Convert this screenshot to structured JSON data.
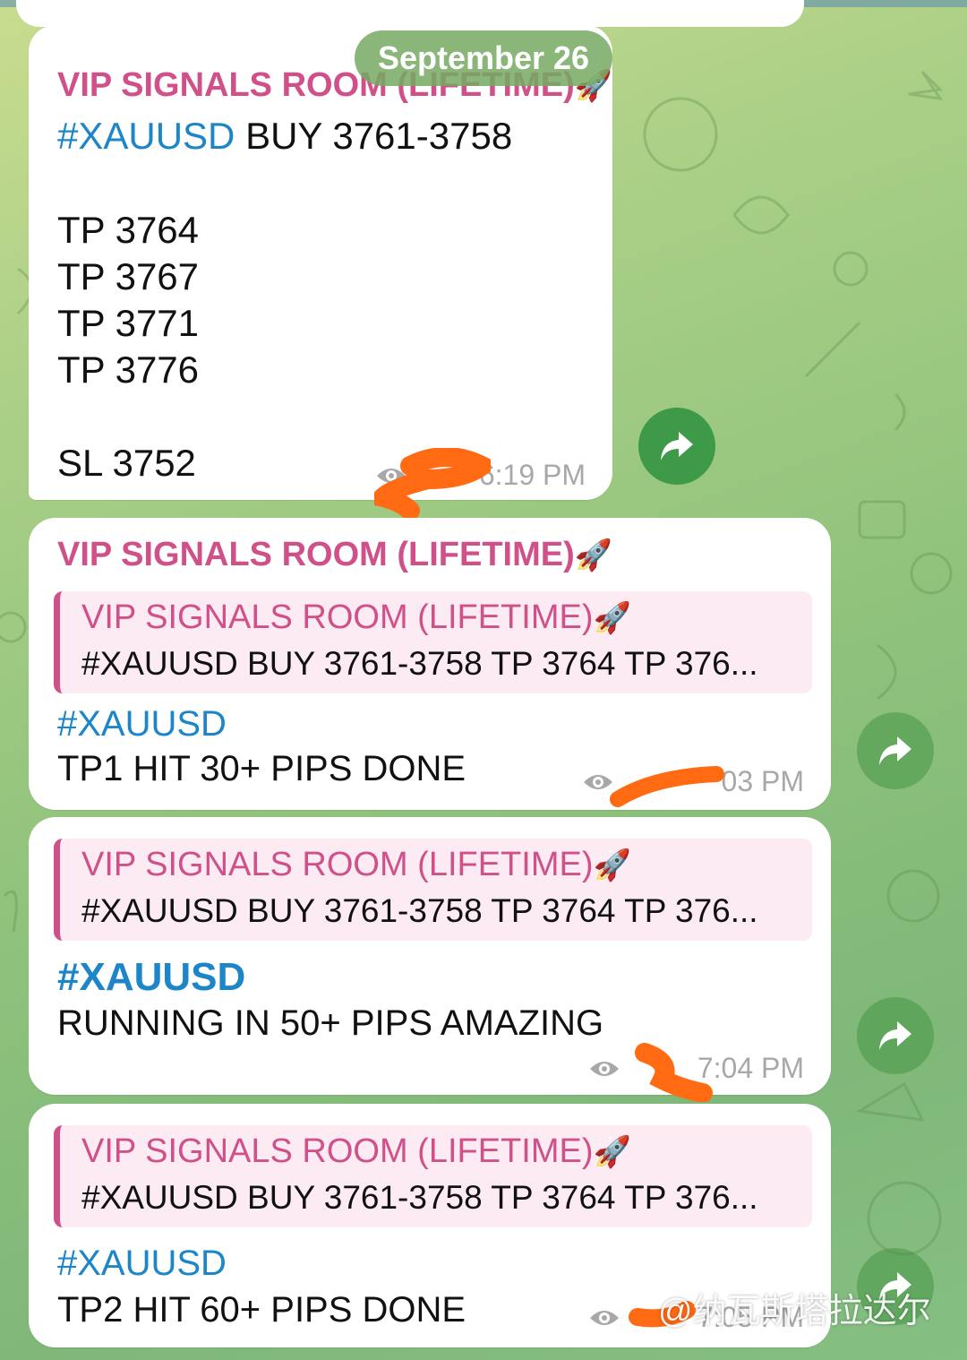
{
  "date_separator": "September 26",
  "messages": [
    {
      "sender": "VIP SIGNALS ROOM (LIFETIME)",
      "sender_emoji": "🚀",
      "tag": "#XAUUSD",
      "signal": " BUY 3761-3758",
      "tp1": "TP 3764",
      "tp2": "TP 3767",
      "tp3": "TP 3771",
      "tp4": "TP 3776",
      "sl": "SL 3752",
      "time": "6:19 PM"
    },
    {
      "sender": "VIP SIGNALS ROOM (LIFETIME)",
      "sender_emoji": "🚀",
      "reply_sender": "VIP SIGNALS ROOM (LIFETIME)",
      "reply_text": "#XAUUSD BUY 3761-3758  TP 3764 TP 376...",
      "tag": "#XAUUSD",
      "text": "TP1 HIT 30+ PIPS DONE",
      "time": "03 PM"
    },
    {
      "reply_sender": "VIP SIGNALS ROOM (LIFETIME)",
      "reply_text": "#XAUUSD BUY 3761-3758  TP 3764 TP 376...",
      "tag": "#XAUUSD",
      "text": "RUNNING IN 50+ PIPS AMAZING",
      "time": "7:04 PM"
    },
    {
      "reply_sender": "VIP SIGNALS ROOM (LIFETIME)",
      "reply_text": "#XAUUSD BUY 3761-3758  TP 3764 TP 376...",
      "tag": "#XAUUSD",
      "text": "TP2 HIT 60+ PIPS DONE",
      "time": "7:05 PM"
    }
  ],
  "watermark": "@纳瓦斯塔拉达尔",
  "colors": {
    "accent": "#d0508a",
    "hashtag": "#1c86c8",
    "redaction": "#ff6a13",
    "forward_button": "#3e9a48"
  }
}
